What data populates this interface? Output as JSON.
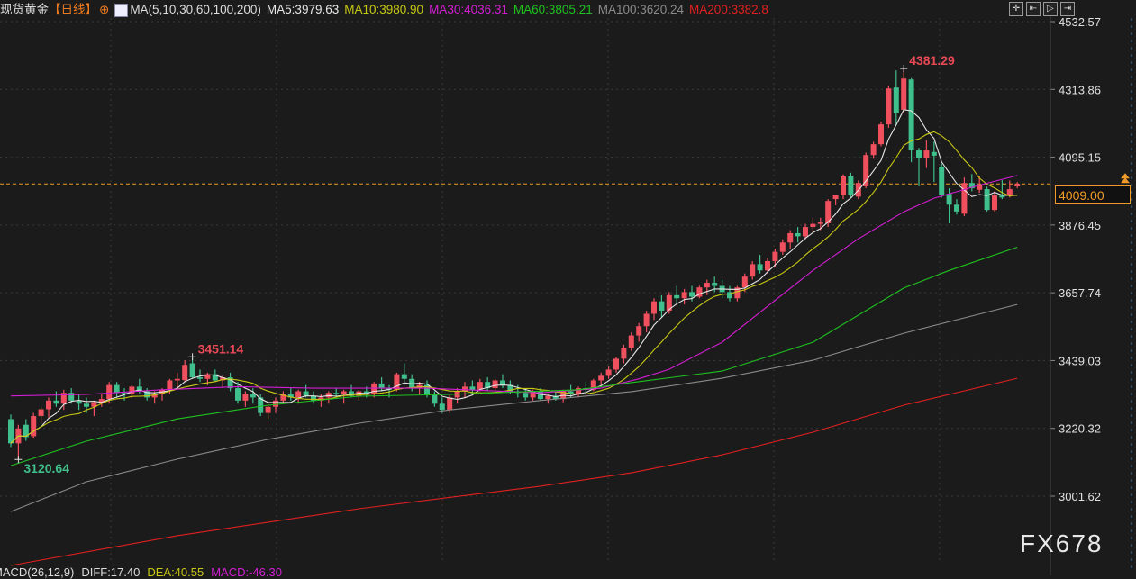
{
  "header": {
    "instrument": "现货黄金",
    "period": "【日线】",
    "indicator": "MA(5,10,30,60,100,200)",
    "ma5": "MA5:3979.63",
    "ma10": "MA10:3980.90",
    "ma30": "MA30:4036.31",
    "ma60": "MA60:3805.21",
    "ma100": "MA100:3620.24",
    "ma200": "MA200:3382.8"
  },
  "toolbar": [
    {
      "icon": "crosshair-icon",
      "glyph": "✛"
    },
    {
      "icon": "first-bar-icon",
      "glyph": "⇤"
    },
    {
      "icon": "play-icon",
      "glyph": "▷"
    },
    {
      "icon": "last-bar-icon",
      "glyph": "⇥"
    }
  ],
  "macd": {
    "title": "MACD(26,12,9)",
    "diff": "DIFF:17.40",
    "dea": "DEA:40.55",
    "macd": "MACD:-46.30"
  },
  "watermark": "FX678",
  "colors": {
    "up": "#f0505e",
    "down": "#3fbf8c",
    "ma5": "#e6e6e6",
    "ma10": "#c8c814",
    "ma30": "#d21ed2",
    "ma60": "#1fc21f",
    "ma100": "#8a8a8a",
    "ma200": "#e02020",
    "last": "#f09a2a"
  },
  "chart_data": {
    "type": "candlestick",
    "yticks": [
      "4532.57",
      "4313.86",
      "4095.15",
      "3876.45",
      "3657.74",
      "3439.03",
      "3220.32",
      "3001.62"
    ],
    "ylim": [
      3001.62,
      4532.57
    ],
    "last_price": "4009.00",
    "annotations": [
      {
        "index": 118,
        "label": "4381.29",
        "kind": "high"
      },
      {
        "index": 24,
        "label": "3451.14",
        "kind": "high"
      },
      {
        "index": 1,
        "label": "3120.64",
        "kind": "low"
      }
    ],
    "ohlc": [
      [
        3250,
        3265,
        3160,
        3172
      ],
      [
        3172,
        3232,
        3120,
        3220
      ],
      [
        3232,
        3250,
        3180,
        3192
      ],
      [
        3195,
        3270,
        3190,
        3260
      ],
      [
        3260,
        3290,
        3235,
        3282
      ],
      [
        3282,
        3320,
        3255,
        3310
      ],
      [
        3310,
        3340,
        3290,
        3300
      ],
      [
        3300,
        3345,
        3280,
        3335
      ],
      [
        3335,
        3350,
        3300,
        3310
      ],
      [
        3310,
        3330,
        3280,
        3300
      ],
      [
        3300,
        3320,
        3270,
        3290
      ],
      [
        3290,
        3310,
        3260,
        3305
      ],
      [
        3305,
        3330,
        3290,
        3315
      ],
      [
        3315,
        3370,
        3300,
        3360
      ],
      [
        3360,
        3370,
        3320,
        3335
      ],
      [
        3335,
        3350,
        3310,
        3330
      ],
      [
        3330,
        3360,
        3320,
        3355
      ],
      [
        3355,
        3380,
        3330,
        3340
      ],
      [
        3340,
        3350,
        3310,
        3320
      ],
      [
        3320,
        3340,
        3300,
        3330
      ],
      [
        3330,
        3350,
        3310,
        3345
      ],
      [
        3345,
        3380,
        3330,
        3375
      ],
      [
        3375,
        3400,
        3350,
        3380
      ],
      [
        3376,
        3440,
        3370,
        3425
      ],
      [
        3430,
        3451,
        3380,
        3385
      ],
      [
        3385,
        3410,
        3370,
        3380
      ],
      [
        3380,
        3400,
        3360,
        3395
      ],
      [
        3395,
        3410,
        3370,
        3375
      ],
      [
        3375,
        3390,
        3350,
        3385
      ],
      [
        3385,
        3400,
        3340,
        3350
      ],
      [
        3350,
        3370,
        3300,
        3310
      ],
      [
        3310,
        3340,
        3290,
        3330
      ],
      [
        3330,
        3350,
        3300,
        3320
      ],
      [
        3320,
        3330,
        3260,
        3270
      ],
      [
        3270,
        3300,
        3250,
        3290
      ],
      [
        3290,
        3320,
        3270,
        3310
      ],
      [
        3310,
        3340,
        3300,
        3330
      ],
      [
        3330,
        3350,
        3310,
        3320
      ],
      [
        3320,
        3345,
        3300,
        3340
      ],
      [
        3340,
        3360,
        3320,
        3325
      ],
      [
        3325,
        3340,
        3300,
        3310
      ],
      [
        3310,
        3330,
        3290,
        3320
      ],
      [
        3320,
        3340,
        3300,
        3335
      ],
      [
        3335,
        3350,
        3320,
        3330
      ],
      [
        3330,
        3345,
        3300,
        3340
      ],
      [
        3340,
        3360,
        3320,
        3325
      ],
      [
        3325,
        3345,
        3310,
        3340
      ],
      [
        3340,
        3355,
        3320,
        3330
      ],
      [
        3330,
        3370,
        3320,
        3365
      ],
      [
        3365,
        3385,
        3340,
        3350
      ],
      [
        3350,
        3360,
        3320,
        3345
      ],
      [
        3345,
        3400,
        3340,
        3395
      ],
      [
        3395,
        3430,
        3370,
        3380
      ],
      [
        3380,
        3395,
        3340,
        3350
      ],
      [
        3350,
        3370,
        3330,
        3360
      ],
      [
        3360,
        3375,
        3320,
        3330
      ],
      [
        3330,
        3340,
        3290,
        3300
      ],
      [
        3300,
        3320,
        3270,
        3280
      ],
      [
        3280,
        3330,
        3270,
        3320
      ],
      [
        3320,
        3350,
        3300,
        3340
      ],
      [
        3340,
        3370,
        3320,
        3355
      ],
      [
        3355,
        3375,
        3330,
        3345
      ],
      [
        3345,
        3380,
        3340,
        3370
      ],
      [
        3370,
        3385,
        3340,
        3350
      ],
      [
        3350,
        3380,
        3340,
        3375
      ],
      [
        3375,
        3395,
        3350,
        3360
      ],
      [
        3360,
        3375,
        3330,
        3340
      ],
      [
        3340,
        3360,
        3320,
        3335
      ],
      [
        3335,
        3350,
        3310,
        3320
      ],
      [
        3320,
        3345,
        3310,
        3340
      ],
      [
        3340,
        3350,
        3310,
        3315
      ],
      [
        3315,
        3330,
        3300,
        3325
      ],
      [
        3325,
        3340,
        3310,
        3315
      ],
      [
        3315,
        3345,
        3305,
        3340
      ],
      [
        3340,
        3360,
        3320,
        3330
      ],
      [
        3330,
        3355,
        3320,
        3350
      ],
      [
        3350,
        3370,
        3330,
        3345
      ],
      [
        3345,
        3380,
        3340,
        3375
      ],
      [
        3375,
        3400,
        3360,
        3390
      ],
      [
        3390,
        3420,
        3380,
        3410
      ],
      [
        3410,
        3450,
        3400,
        3445
      ],
      [
        3445,
        3490,
        3430,
        3480
      ],
      [
        3480,
        3530,
        3470,
        3520
      ],
      [
        3520,
        3560,
        3500,
        3550
      ],
      [
        3550,
        3600,
        3530,
        3590
      ],
      [
        3590,
        3640,
        3570,
        3630
      ],
      [
        3630,
        3650,
        3580,
        3600
      ],
      [
        3600,
        3660,
        3590,
        3650
      ],
      [
        3650,
        3680,
        3620,
        3640
      ],
      [
        3640,
        3670,
        3620,
        3660
      ],
      [
        3660,
        3680,
        3630,
        3645
      ],
      [
        3645,
        3680,
        3640,
        3675
      ],
      [
        3675,
        3700,
        3650,
        3690
      ],
      [
        3690,
        3710,
        3660,
        3680
      ],
      [
        3680,
        3700,
        3640,
        3660
      ],
      [
        3660,
        3680,
        3630,
        3640
      ],
      [
        3640,
        3680,
        3630,
        3675
      ],
      [
        3675,
        3720,
        3660,
        3710
      ],
      [
        3710,
        3760,
        3700,
        3750
      ],
      [
        3750,
        3780,
        3720,
        3730
      ],
      [
        3730,
        3770,
        3720,
        3760
      ],
      [
        3760,
        3800,
        3740,
        3790
      ],
      [
        3790,
        3830,
        3780,
        3820
      ],
      [
        3820,
        3860,
        3800,
        3850
      ],
      [
        3850,
        3870,
        3820,
        3840
      ],
      [
        3840,
        3880,
        3830,
        3870
      ],
      [
        3870,
        3900,
        3850,
        3880
      ],
      [
        3880,
        3900,
        3860,
        3885
      ],
      [
        3882,
        3960,
        3870,
        3954
      ],
      [
        3960,
        3975,
        3940,
        3972
      ],
      [
        3972,
        4040,
        3960,
        4033
      ],
      [
        4033,
        4045,
        3965,
        3972
      ],
      [
        3968,
        4020,
        3960,
        4012
      ],
      [
        4001,
        4110,
        3995,
        4102
      ],
      [
        4102,
        4145,
        4090,
        4137
      ],
      [
        4137,
        4210,
        4130,
        4201
      ],
      [
        4201,
        4325,
        4190,
        4317
      ],
      [
        4320,
        4375,
        4200,
        4239
      ],
      [
        4248,
        4381,
        4240,
        4349
      ],
      [
        4346,
        4350,
        4079,
        4117
      ],
      [
        4117,
        4125,
        4001,
        4094
      ],
      [
        4091,
        4150,
        4060,
        4117
      ],
      [
        4112,
        4145,
        4015,
        4100
      ],
      [
        4065,
        4075,
        3965,
        3972
      ],
      [
        3977,
        3995,
        3882,
        3942
      ],
      [
        3942,
        3960,
        3910,
        3920
      ],
      [
        3913,
        4030,
        3905,
        4012
      ],
      [
        4012,
        4041,
        3985,
        3995
      ],
      [
        3990,
        4035,
        3980,
        4005
      ],
      [
        3992,
        4000,
        3920,
        3925
      ],
      [
        3925,
        3985,
        3920,
        3972
      ],
      [
        3972,
        4021,
        3960,
        3965
      ],
      [
        3972,
        4020,
        3965,
        3992
      ],
      [
        4001,
        4015,
        3995,
        4009
      ]
    ],
    "ma_series": [
      {
        "name": "MA5",
        "period": 5,
        "computed": true
      },
      {
        "name": "MA10",
        "period": 10,
        "computed": true
      },
      {
        "name": "MA30",
        "points": [
          [
            0,
            3325
          ],
          [
            10,
            3330
          ],
          [
            20,
            3345
          ],
          [
            30,
            3355
          ],
          [
            40,
            3350
          ],
          [
            55,
            3350
          ],
          [
            70,
            3335
          ],
          [
            78,
            3350
          ],
          [
            83,
            3380
          ],
          [
            87,
            3411
          ],
          [
            94,
            3498
          ],
          [
            100,
            3614
          ],
          [
            106,
            3730
          ],
          [
            112,
            3832
          ],
          [
            118,
            3919
          ],
          [
            122,
            3963
          ],
          [
            128,
            4005
          ],
          [
            133,
            4036
          ]
        ]
      },
      {
        "name": "MA60",
        "points": [
          [
            0,
            3100
          ],
          [
            10,
            3179
          ],
          [
            22,
            3251
          ],
          [
            34,
            3295
          ],
          [
            46,
            3324
          ],
          [
            58,
            3330
          ],
          [
            75,
            3345
          ],
          [
            82,
            3368
          ],
          [
            94,
            3405
          ],
          [
            106,
            3498
          ],
          [
            118,
            3673
          ],
          [
            124,
            3730
          ],
          [
            133,
            3805
          ]
        ]
      },
      {
        "name": "MA100",
        "points": [
          [
            0,
            2952
          ],
          [
            10,
            3048
          ],
          [
            22,
            3121
          ],
          [
            34,
            3185
          ],
          [
            46,
            3237
          ],
          [
            58,
            3280
          ],
          [
            70,
            3310
          ],
          [
            82,
            3339
          ],
          [
            94,
            3382
          ],
          [
            106,
            3440
          ],
          [
            118,
            3527
          ],
          [
            133,
            3620
          ]
        ]
      },
      {
        "name": "MA200",
        "points": [
          [
            0,
            2778
          ],
          [
            22,
            2874
          ],
          [
            46,
            2961
          ],
          [
            70,
            3034
          ],
          [
            82,
            3077
          ],
          [
            94,
            3135
          ],
          [
            106,
            3208
          ],
          [
            118,
            3295
          ],
          [
            133,
            3382
          ]
        ]
      }
    ]
  }
}
